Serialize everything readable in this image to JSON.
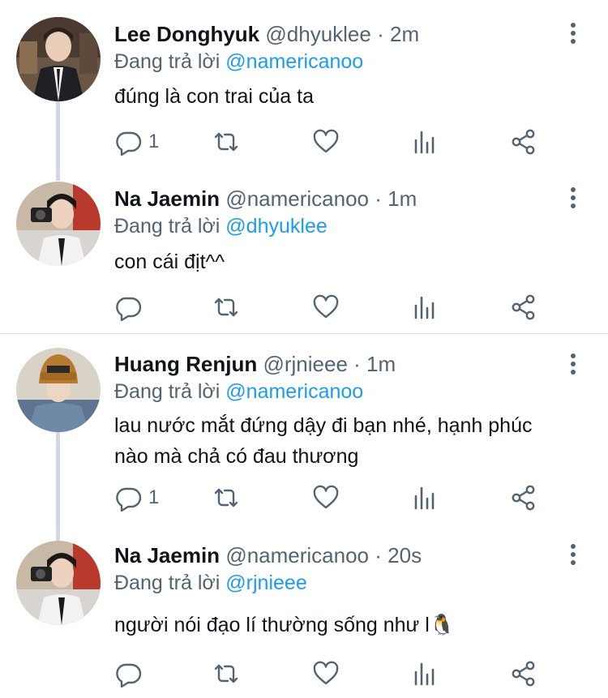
{
  "tweets": [
    {
      "name": "Lee Donghyuk",
      "handle": "@dhyuklee",
      "dot": "·",
      "time": "2m",
      "reply_prefix": "Đang trả lời",
      "reply_to": "@namericanoo",
      "text": "đúng là con trai của ta",
      "reply_count": "1",
      "avatar": "person-photo-dark-suit"
    },
    {
      "name": "Na Jaemin",
      "handle": "@namericanoo",
      "dot": "·",
      "time": "1m",
      "reply_prefix": "Đang trả lời",
      "reply_to": "@dhyuklee",
      "text": "con cái địt^^",
      "reply_count": "",
      "avatar": "person-photo-camera"
    },
    {
      "name": "Huang Renjun",
      "handle": "@rjnieee",
      "dot": "·",
      "time": "1m",
      "reply_prefix": "Đang trả lời",
      "reply_to": "@namericanoo",
      "text": "lau nước mắt đứng dậy đi bạn nhé, hạnh phúc\nnào mà chả có đau thương",
      "reply_count": "1",
      "avatar": "person-photo-knit-hat"
    },
    {
      "name": "Na Jaemin",
      "handle": "@namericanoo",
      "dot": "·",
      "time": "20s",
      "reply_prefix": "Đang trả lời",
      "reply_to": "@rjnieee",
      "text": "người nói đạo lí thường sống như l🐧",
      "reply_count": "",
      "avatar": "person-photo-camera"
    }
  ],
  "icons": {
    "reply": "reply-bubble-icon",
    "retweet": "retweet-icon",
    "like": "heart-icon",
    "views": "views-bar-chart-icon",
    "share": "share-icon",
    "more": "more-vertical-icon"
  },
  "colors": {
    "link": "#1d9bf0",
    "secondary": "#536471",
    "primary_text": "#0f1419",
    "thread_line": "#cfd9de",
    "divider": "#dfe3e6"
  }
}
